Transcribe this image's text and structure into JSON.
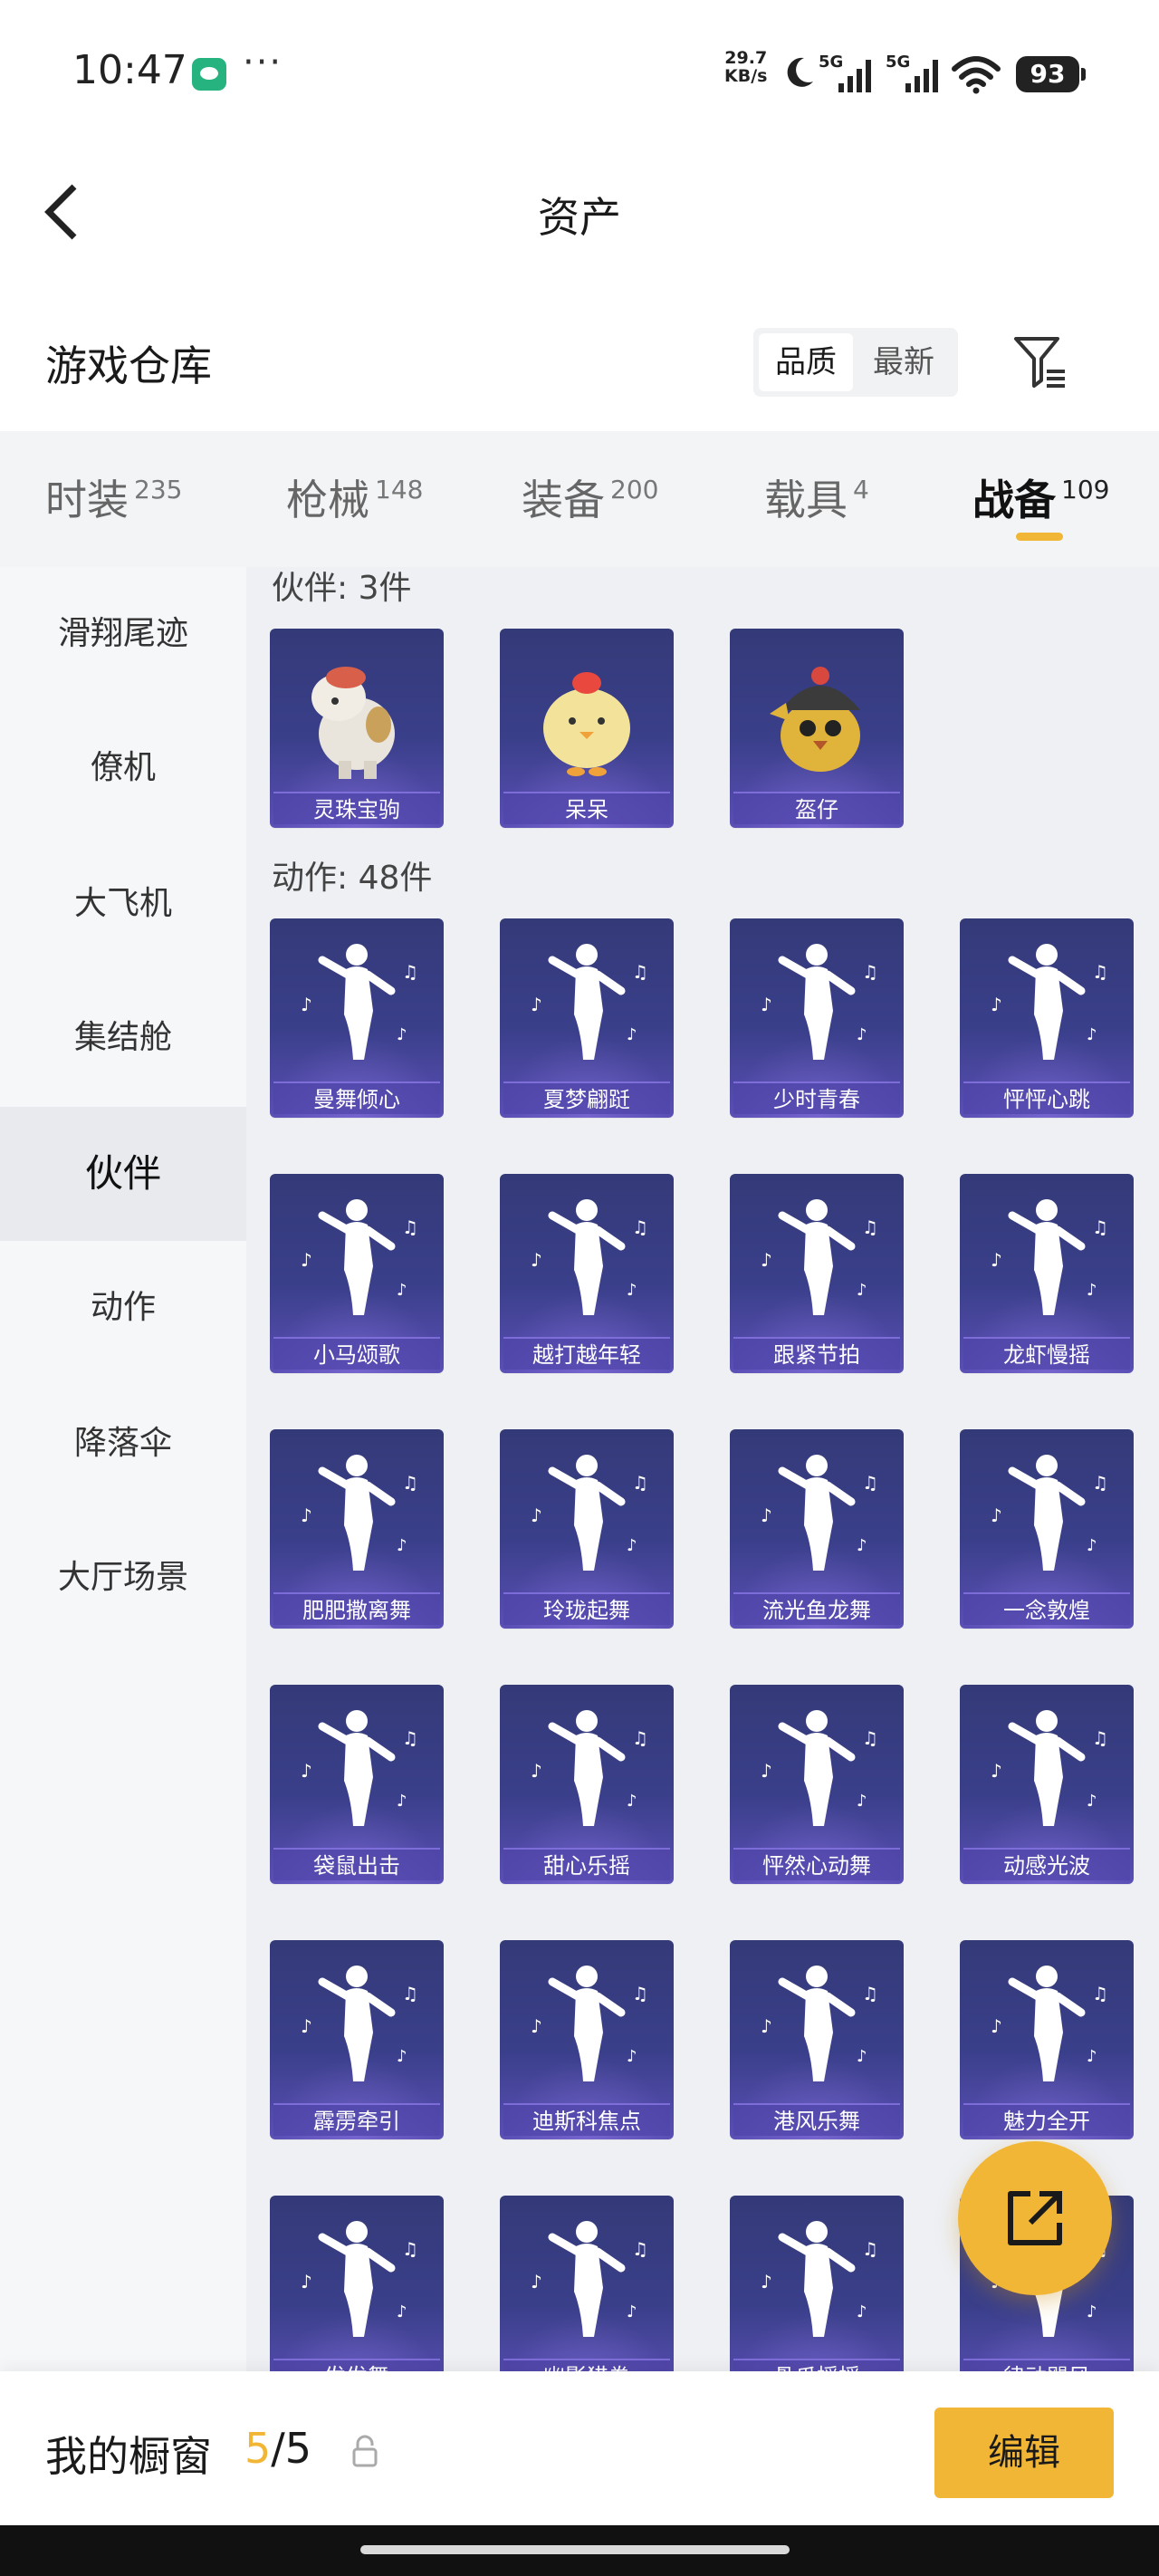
{
  "status_bar": {
    "time": "10:47",
    "net_speed_value": "29.7",
    "net_speed_unit": "KB/s",
    "signal_1": "5G",
    "signal_2": "5G",
    "battery": "93"
  },
  "header": {
    "title": "资产"
  },
  "warehouse": {
    "title": "游戏仓库",
    "sort_options": [
      "品质",
      "最新"
    ],
    "active_sort": "品质"
  },
  "category_tabs": [
    {
      "label": "时装",
      "count": "235"
    },
    {
      "label": "枪械",
      "count": "148"
    },
    {
      "label": "装备",
      "count": "200"
    },
    {
      "label": "载具",
      "count": "4"
    },
    {
      "label": "战备",
      "count": "109"
    }
  ],
  "active_category": "战备",
  "sidebar": {
    "items": [
      "滑翔尾迹",
      "僚机",
      "大飞机",
      "集结舱",
      "伙伴",
      "动作",
      "降落伞",
      "大厅场景"
    ],
    "active": "伙伴"
  },
  "sections": {
    "partners": {
      "label": "伙伴: 3件",
      "items": [
        "灵珠宝驹",
        "呆呆",
        "盔仔"
      ]
    },
    "emotes": {
      "label": "动作: 48件",
      "items": [
        "曼舞倾心",
        "夏梦翩跹",
        "少时青春",
        "怦怦心跳",
        "小马颂歌",
        "越打越年轻",
        "跟紧节拍",
        "龙虾慢摇",
        "肥肥撒离舞",
        "玲珑起舞",
        "流光鱼龙舞",
        "一念敦煌",
        "袋鼠出击",
        "甜心乐摇",
        "怦然心动舞",
        "动感光波",
        "霹雳牵引",
        "迪斯科焦点",
        "港风乐舞",
        "魅力全开",
        "发发舞",
        "幽影猎拳",
        "骨爪摇摇",
        "律动飓风"
      ]
    }
  },
  "showcase": {
    "label": "我的橱窗",
    "current": "5",
    "separator": "/",
    "total": "5",
    "edit_label": "编辑"
  },
  "colors": {
    "accent": "#f2b636",
    "card_bg": "#3a3f8a",
    "content_bg": "#eef0f4"
  }
}
